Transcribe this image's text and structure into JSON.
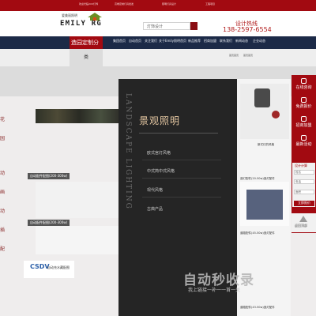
{
  "topbar": {
    "items": [
      "欢迎光临XXX灯饰",
      "高端定制灯具批发",
      "照明灯具设计",
      "工程项目"
    ]
  },
  "header": {
    "logo_sub": "爱美丽照明",
    "logo_main": "EMILY RG",
    "search_placeholder": "灯饰设计",
    "hotline_label": "设计热线",
    "hotline_number": "138-2597-6554"
  },
  "nav": {
    "active_tab": "造园定制分",
    "items": [
      "集团首页",
      "自动首页",
      "关注我们",
      "关于Emily照明首页",
      "新品推荐",
      "招商加盟",
      "联系我们",
      "新闻动态",
      "企业动态"
    ]
  },
  "strip": {
    "dropdown_label": "类",
    "breadcrumb": [
      "首页首页",
      "首页首页"
    ]
  },
  "left": {
    "letters": [
      "花",
      "园",
      "动",
      "画",
      "动",
      "插",
      "配"
    ],
    "captions": [
      "自动配件配图(200-300w)",
      "自动配件配图(200-300w)"
    ],
    "logo_brand": "CSDV",
    "logo_text": "自动充水藏配图"
  },
  "panel": {
    "title": "景观照明",
    "vertical": "LANDSCAPE LIGHTING",
    "items": [
      "欧式宫灯风格",
      "中式简中式风格",
      "现代风格",
      "古典产品"
    ],
    "right_captions": [
      "新式灯的风格",
      "造灯配件(20-50w)造灯配件",
      "道路配件(45-50w)造灯配件",
      "道路配件(43-50w)造灯配件"
    ]
  },
  "watermark": {
    "main": "自动秒收录",
    "sub": "我上链接一补一一首一关"
  },
  "float": {
    "items": [
      "在线咨询",
      "免费报价",
      "招商加盟",
      "最新活动"
    ],
    "form_title": "设计计算",
    "fields": [
      "姓名",
      "电话",
      "面积"
    ],
    "submit": "立即报价",
    "top": "返回顶部"
  },
  "colors": {
    "brand_red": "#a20a11",
    "nav_blue": "#1c2a47",
    "panel_dark": "#252525"
  }
}
